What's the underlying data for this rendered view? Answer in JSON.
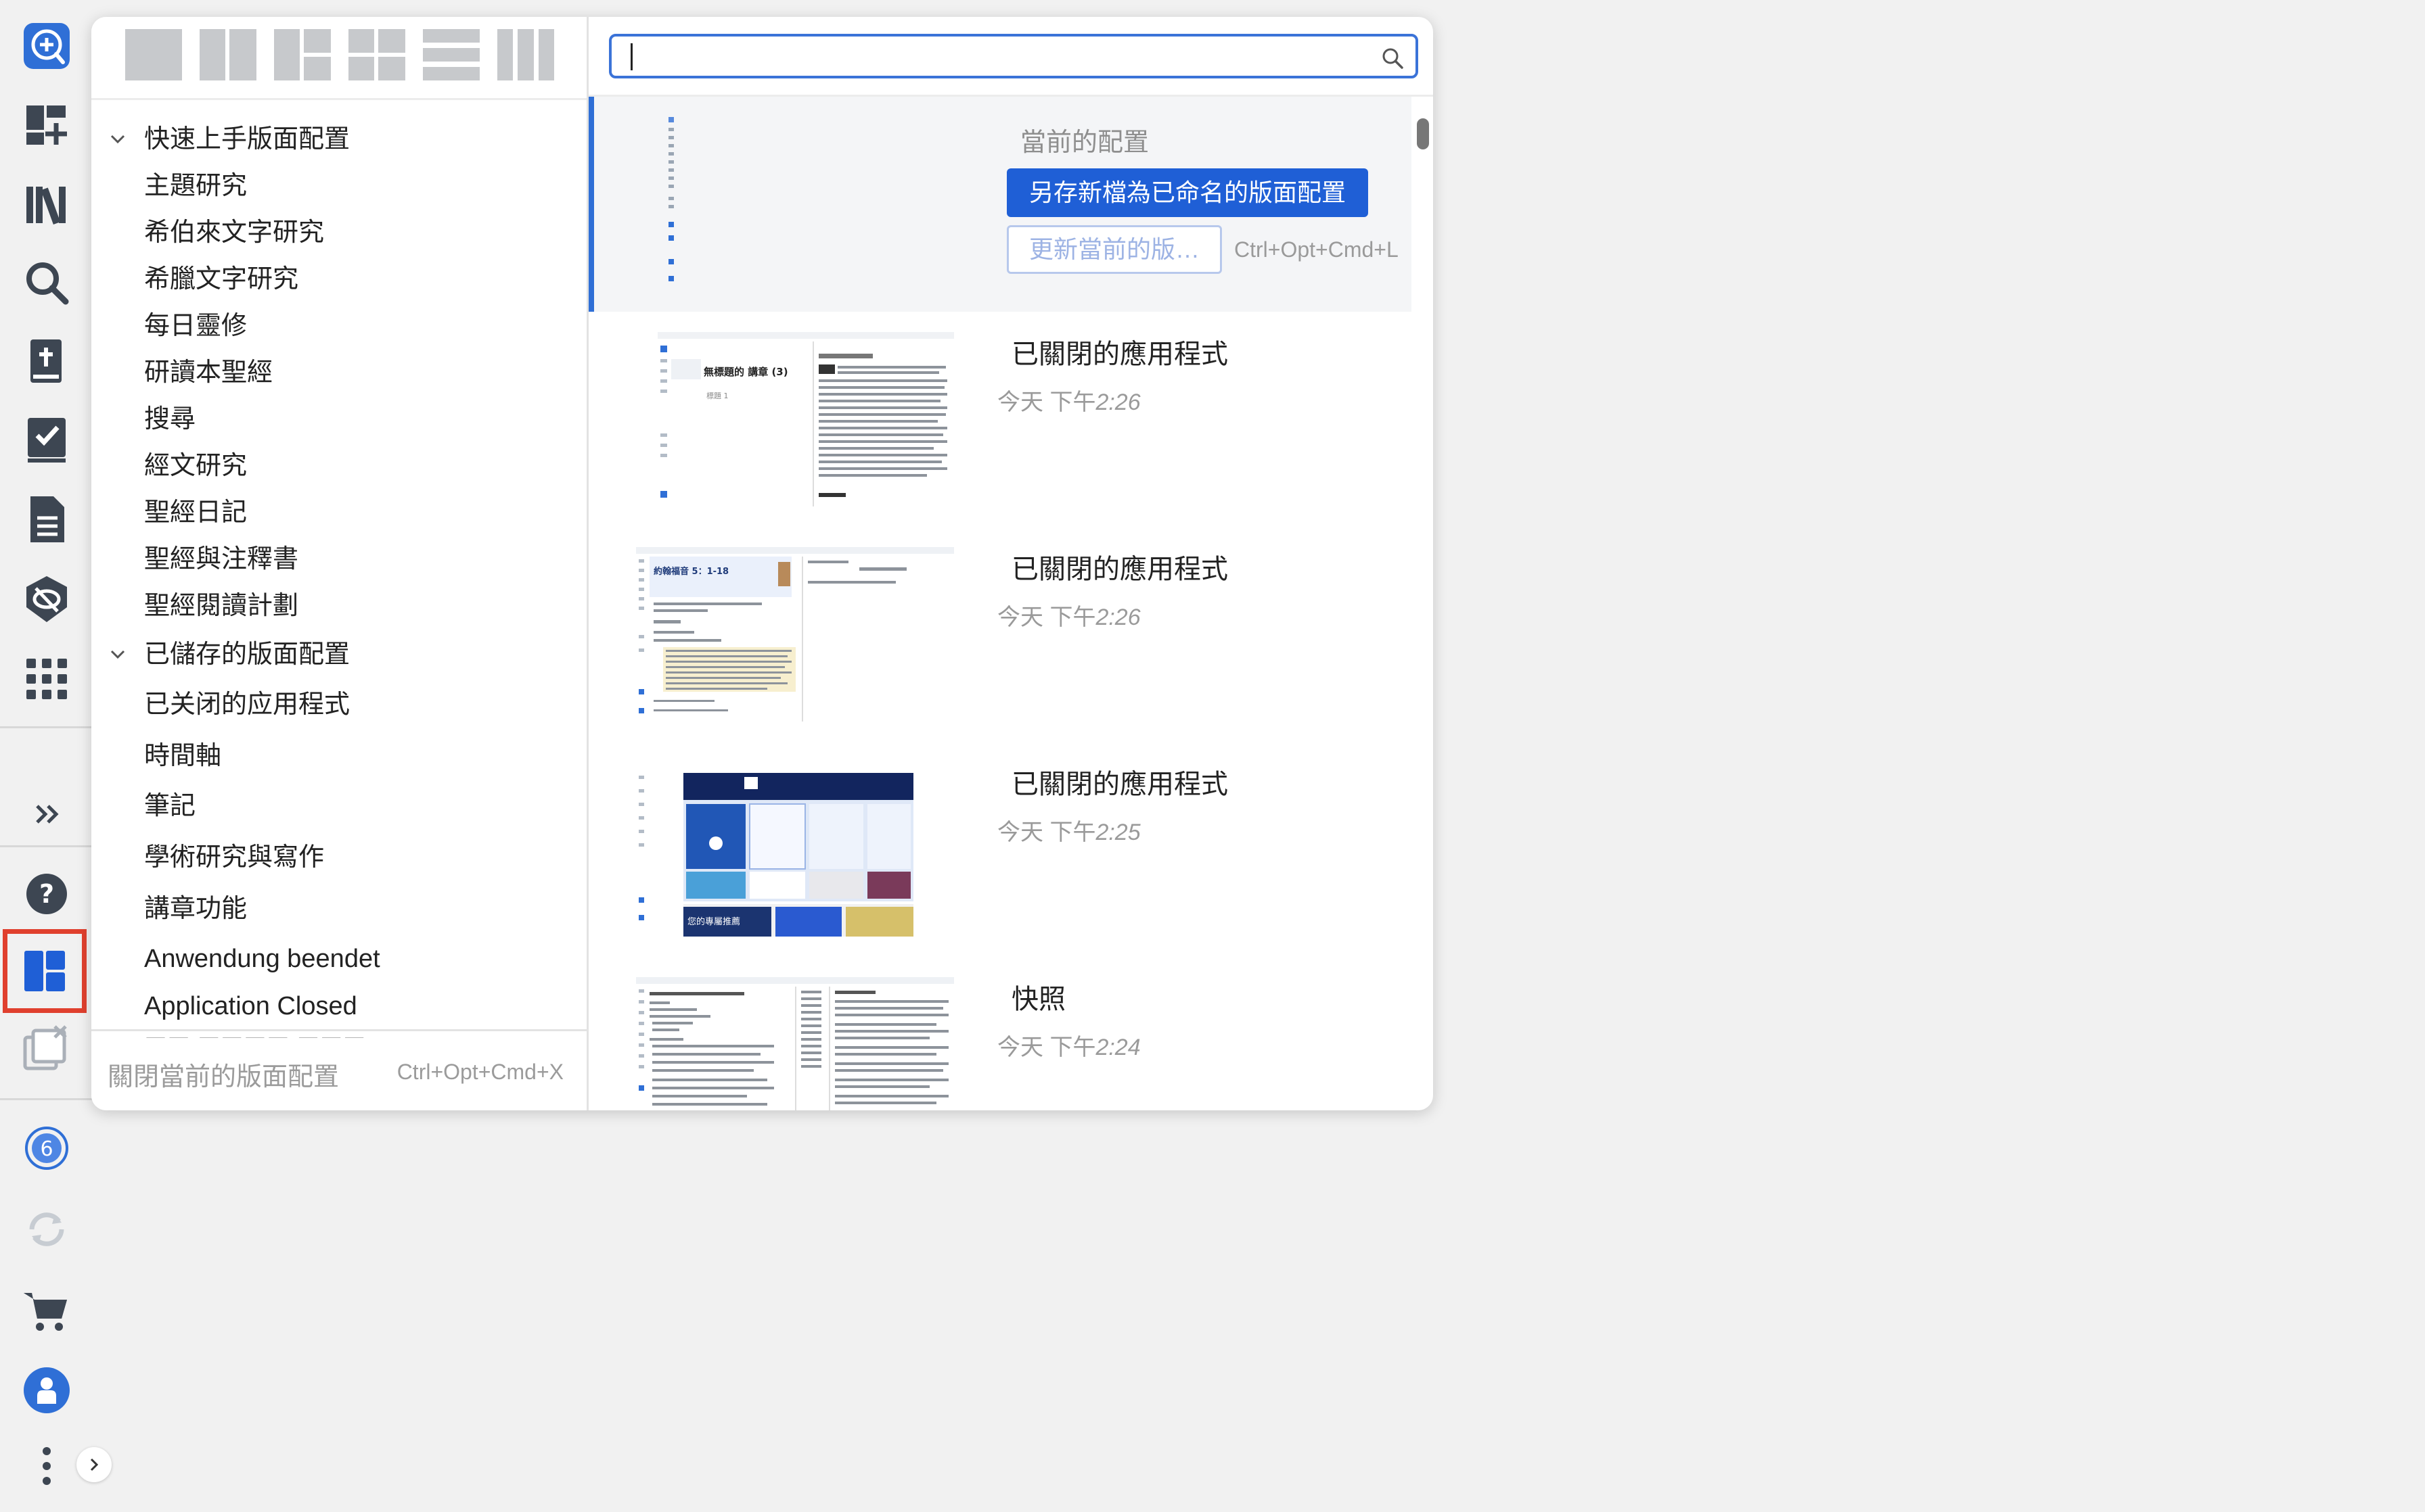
{
  "sidebar": {
    "icons": [
      "logos-logo-icon",
      "dashboard-add-icon",
      "library-icon",
      "search-icon",
      "bible-add-icon",
      "tasks-icon",
      "document-icon",
      "hide-icon",
      "apps-grid-icon",
      "expand-icon",
      "help-icon",
      "layouts-icon",
      "closed-windows-icon",
      "notifications-icon",
      "sync-icon",
      "cart-icon",
      "account-icon",
      "more-icon"
    ],
    "notification_count": "6"
  },
  "layouts_panel": {
    "layout_presets": [
      "single-pane-icon",
      "two-column-icon",
      "three-pane-icon",
      "four-pane-icon",
      "rows-icon",
      "three-column-icon"
    ],
    "tree": [
      {
        "type": "group",
        "label": "快速上手版面配置",
        "expanded": true
      },
      {
        "type": "item",
        "label": "主題研究"
      },
      {
        "type": "item",
        "label": "希伯來文字研究"
      },
      {
        "type": "item",
        "label": "希臘文字研究"
      },
      {
        "type": "item",
        "label": "每日靈修"
      },
      {
        "type": "item",
        "label": "研讀本聖經"
      },
      {
        "type": "item",
        "label": "搜尋"
      },
      {
        "type": "item",
        "label": "經文研究"
      },
      {
        "type": "item",
        "label": "聖經日記"
      },
      {
        "type": "item",
        "label": "聖經與注釋書"
      },
      {
        "type": "item",
        "label": "聖經閱讀計劃"
      },
      {
        "type": "group",
        "label": "已儲存的版面配置",
        "expanded": true
      },
      {
        "type": "item",
        "label": "已关闭的应用程式"
      },
      {
        "type": "item",
        "label": "時間軸"
      },
      {
        "type": "item",
        "label": "筆記"
      },
      {
        "type": "item",
        "label": "學術研究與寫作"
      },
      {
        "type": "item",
        "label": "講章功能"
      },
      {
        "type": "item",
        "label": "Anwendung beendet"
      },
      {
        "type": "item",
        "label": "Application Closed"
      },
      {
        "type": "item",
        "label": "☐☐ ☐☐☐☐ ☐☐☐"
      }
    ],
    "close_current": "關閉當前的版面配置",
    "close_shortcut": "Ctrl+Opt+Cmd+X",
    "search_placeholder": "",
    "current": {
      "label": "當前的配置",
      "save_named": "另存新檔為已命名的版面配置",
      "update": "更新當前的版…",
      "update_shortcut": "Ctrl+Opt+Cmd+L"
    },
    "saved": [
      {
        "title": "已關閉的應用程式",
        "day": "今天 下午",
        "time": "2:26"
      },
      {
        "title": "已關閉的應用程式",
        "day": "今天 下午",
        "time": "2:26"
      },
      {
        "title": "已關閉的應用程式",
        "day": "今天 下午",
        "time": "2:25"
      },
      {
        "title": "快照",
        "day": "今天 下午",
        "time": "2:24"
      }
    ],
    "thumb_texts": {
      "t1_heading": "無標題的 講章 (3)",
      "t1_sub": "標題 1",
      "t2_heading": "約翰福音 5：1-18",
      "t3_banner": "您的專屬推薦"
    }
  },
  "colors": {
    "accent": "#1f5fd6",
    "rail_icon": "#3d4652",
    "active_outline": "#e0402e",
    "brand_blue": "#2f6fd6"
  }
}
